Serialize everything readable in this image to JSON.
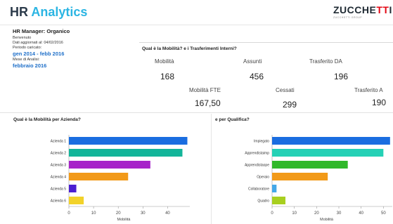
{
  "app": {
    "title_part1": "HR ",
    "title_part2": "Analytics",
    "logo_main": "ZUCCHE",
    "logo_accent": "TT",
    "logo_end": "I",
    "logo_sub": "ZUCCHETTI GROUP"
  },
  "info": {
    "manager": "HR Manager: Organico",
    "welcome": "Benvenuto",
    "updated": "Dati aggiornati al: 04/02/2016",
    "period_label": "Periodo caricato:",
    "period_value": "gen 2014 - febb 2016",
    "month_label": "Mese di Analisi:",
    "month_value": "febbraio 2016"
  },
  "kpi": {
    "question": "Qual è la Mobilità? e i Trasferimenti Interni?",
    "items": [
      {
        "label": "Mobilità",
        "value": "168"
      },
      {
        "label": "Assunti",
        "value": "456"
      },
      {
        "label": "Trasferito DA",
        "value": "196"
      },
      {
        "label": "Mobilità FTE",
        "value": "167,50"
      },
      {
        "label": "Cessati",
        "value": "299"
      },
      {
        "label": "Trasferito A",
        "value": "190"
      }
    ]
  },
  "chart_data": [
    {
      "type": "bar",
      "orientation": "horizontal",
      "title": "Qual è la Mobilità per Azienda?",
      "categories": [
        "Azienda 1",
        "Azienda 2",
        "Azienda 3",
        "Azienda 4",
        "Azienda 5",
        "Azienda 6"
      ],
      "values": [
        48,
        46,
        33,
        24,
        3,
        6
      ],
      "colors": [
        "#1a6de0",
        "#13b59a",
        "#a723c9",
        "#f29a19",
        "#4a1fd1",
        "#f2d22a"
      ],
      "xlabel": "Mobilità",
      "xticks": [
        "0",
        "10",
        "20",
        "30",
        "40"
      ],
      "xlim": [
        0,
        49
      ]
    },
    {
      "type": "bar",
      "orientation": "horizontal",
      "title": "e per Qualifica?",
      "categories": [
        "Impiegato",
        "Apprendistaimp",
        "Apprendistaope",
        "Operaio",
        "Collaboratore",
        "Quadro"
      ],
      "values": [
        53,
        50,
        34,
        25,
        2,
        6
      ],
      "colors": [
        "#1a6de0",
        "#25d1b6",
        "#30b82a",
        "#f29a19",
        "#45a8e8",
        "#a8cf20"
      ],
      "xlabel": "Mobilità",
      "xticks": [
        "0",
        "10",
        "20",
        "30",
        "40",
        "50"
      ],
      "xlim": [
        0,
        54
      ]
    }
  ]
}
